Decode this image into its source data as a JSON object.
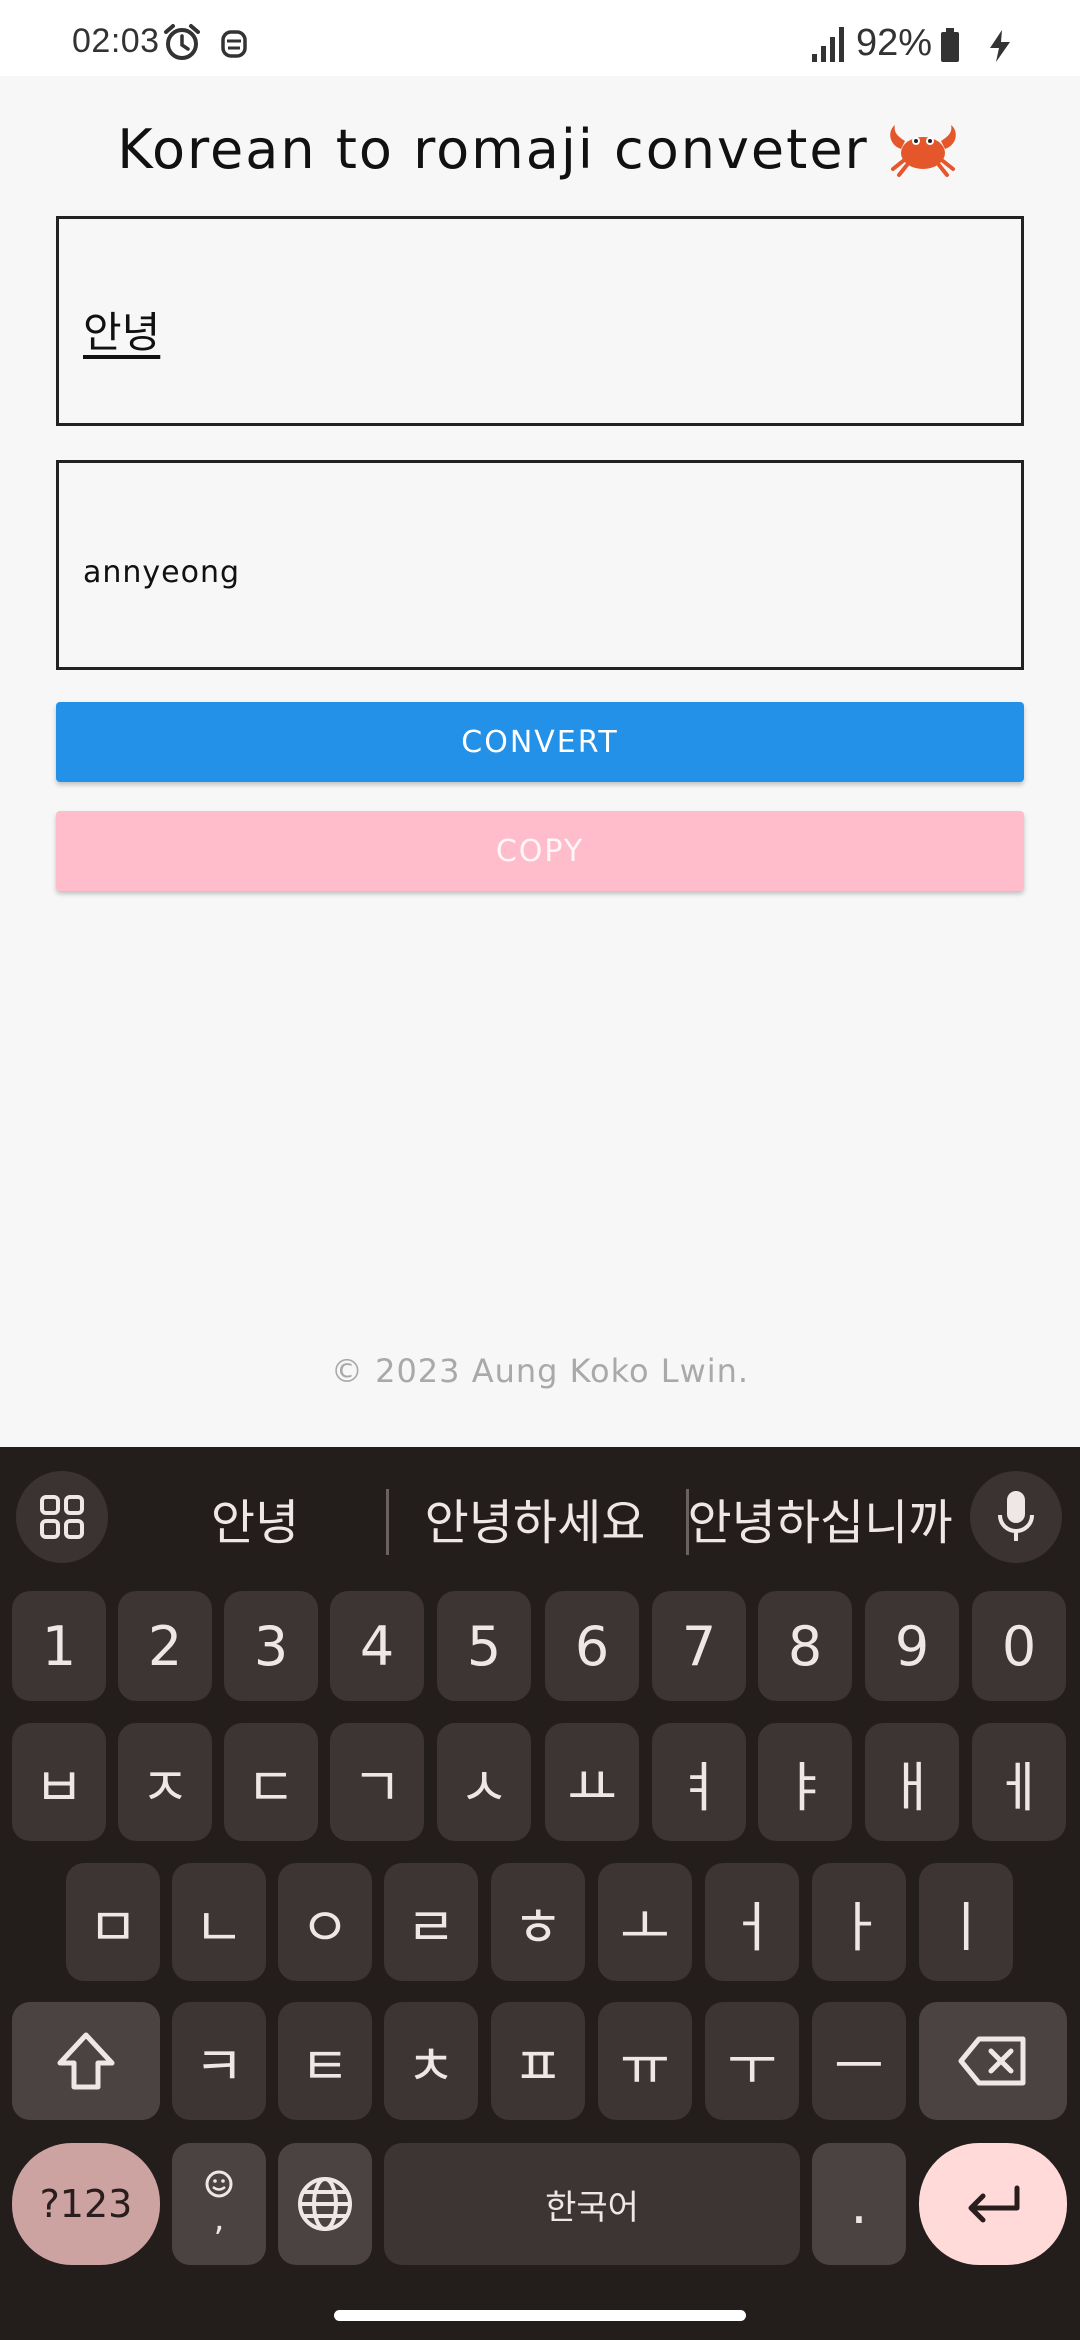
{
  "status_bar": {
    "time": "02:03",
    "battery": "92%"
  },
  "app": {
    "title": "Korean to romaji conveter",
    "input_value": "안녕",
    "output_value": "annyeong",
    "convert_label": "CONVERT",
    "copy_label": "COPY",
    "footer": "© 2023 Aung Koko Lwin.",
    "colors": {
      "convert": "#2391e8",
      "copy": "#ffbccb"
    }
  },
  "keyboard": {
    "suggestions": [
      "안녕",
      "안녕하세요",
      "안녕하십니까"
    ],
    "row_numbers": [
      "1",
      "2",
      "3",
      "4",
      "5",
      "6",
      "7",
      "8",
      "9",
      "0"
    ],
    "row1": [
      "ㅂ",
      "ㅈ",
      "ㄷ",
      "ㄱ",
      "ㅅ",
      "ㅛ",
      "ㅕ",
      "ㅑ",
      "ㅐ",
      "ㅔ"
    ],
    "row2": [
      "ㅁ",
      "ㄴ",
      "ㅇ",
      "ㄹ",
      "ㅎ",
      "ㅗ",
      "ㅓ",
      "ㅏ",
      "ㅣ"
    ],
    "row3": [
      "ㅋ",
      "ㅌ",
      "ㅊ",
      "ㅍ",
      "ㅠ",
      "ㅜ",
      "ㅡ"
    ],
    "symbols_label": "?123",
    "emoji_comma": ",",
    "space_label": "한국어",
    "period_label": "."
  }
}
